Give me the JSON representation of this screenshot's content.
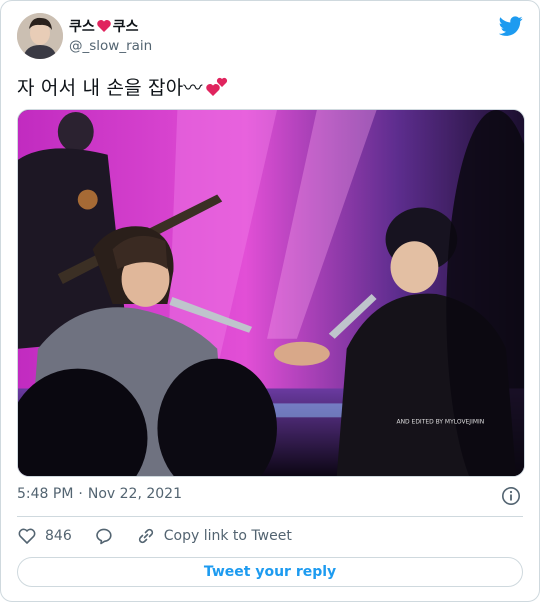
{
  "tweet": {
    "display_name_part1": "쿠스",
    "display_name_part2": "쿠스",
    "handle": "@_slow_rain",
    "text": "자 어서 내 손을 잡아〰",
    "timestamp_time": "5:48 PM",
    "timestamp_sep": "·",
    "timestamp_date": "Nov 22, 2021",
    "watermark": "AND EDITED BY   MYLOVEJIMIN"
  },
  "actions": {
    "like_count": "846",
    "copy_link_label": "Copy link to Tweet",
    "reply_label": "Tweet your reply"
  },
  "colors": {
    "accent": "#1d9bf0",
    "heart": "#e0245e",
    "secondary_text": "#536471",
    "border": "#cfd9de"
  },
  "icons": [
    "twitter-bird-icon",
    "red-heart-icon",
    "two-hearts-icon",
    "info-icon",
    "like-heart-icon",
    "reply-bubble-icon",
    "link-icon"
  ]
}
